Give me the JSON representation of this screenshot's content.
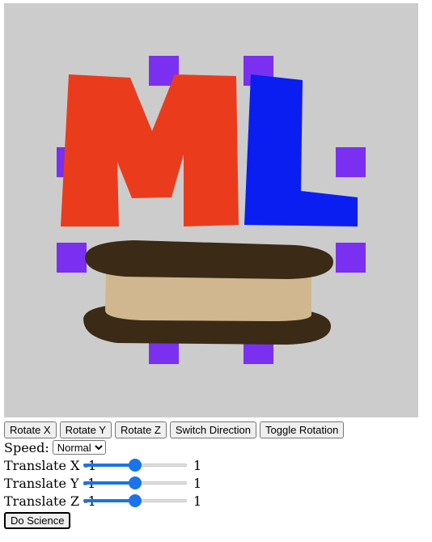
{
  "scene": {
    "logo_text": "ML",
    "colors": {
      "background": "#cccccc",
      "letter_m": "#ea3c1c",
      "letter_l": "#0a1ef2",
      "markers": "#7b2ff0",
      "cookie": "#3a2a16",
      "cream": "#d0b78f"
    }
  },
  "toolbar": {
    "rotate_x": "Rotate X",
    "rotate_y": "Rotate Y",
    "rotate_z": "Rotate Z",
    "switch_direction": "Switch Direction",
    "toggle_rotation": "Toggle Rotation"
  },
  "speed": {
    "label": "Speed:",
    "selected": "Normal"
  },
  "sliders": [
    {
      "label": "Translate X",
      "min": "-1",
      "max": "1",
      "value": 0
    },
    {
      "label": "Translate Y",
      "min": "-1",
      "max": "1",
      "value": 0
    },
    {
      "label": "Translate Z",
      "min": "-1",
      "max": "1",
      "value": 0
    }
  ],
  "actions": {
    "do_science": "Do Science"
  }
}
